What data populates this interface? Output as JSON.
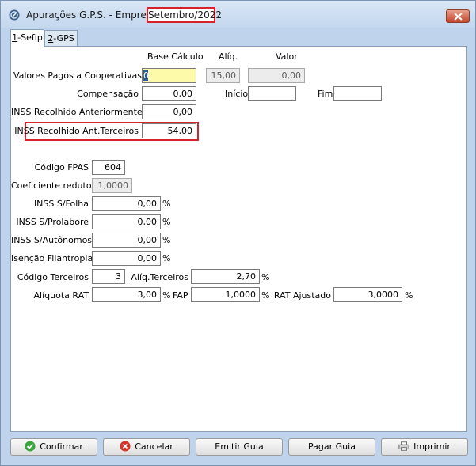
{
  "window": {
    "title": "Apurações G.P.S. - Empresa - ",
    "period": "Setembro/2022"
  },
  "tabs": [
    {
      "key": "1",
      "label": "-Sefip"
    },
    {
      "key": "2",
      "label": "-GPS"
    }
  ],
  "headers": {
    "base": "Base Cálculo",
    "aliq": "Alíq.",
    "valor": "Valor"
  },
  "form": {
    "cooperativas": {
      "label": "Valores Pagos a Cooperativas",
      "base": "0",
      "aliq": "15,00",
      "valor": "0,00"
    },
    "compensacao": {
      "label": "Compensação",
      "value": "0,00",
      "inicio_label": "Início",
      "inicio": "",
      "fim_label": "Fim",
      "fim": ""
    },
    "inss_anterior": {
      "label": "INSS Recolhido Anteriormente",
      "value": "0,00"
    },
    "inss_terceiros": {
      "label": "INSS Recolhido Ant.Terceiros",
      "value": "54,00"
    },
    "codigo_fpas": {
      "label": "Código FPAS",
      "value": "604"
    },
    "coef_redutor": {
      "label": "Coeficiente redutor",
      "value": "1,0000"
    },
    "inss_folha": {
      "label": "INSS S/Folha",
      "value": "0,00",
      "unit": "%"
    },
    "inss_prolabore": {
      "label": "INSS S/Prolabore",
      "value": "0,00",
      "unit": "%"
    },
    "inss_autonomos": {
      "label": "INSS S/Autônomos",
      "value": "0,00",
      "unit": "%"
    },
    "isencao": {
      "label": "Isenção Filantropia",
      "value": "0,00",
      "unit": "%"
    },
    "codigo_terceiros": {
      "label": "Código Terceiros",
      "value": "3"
    },
    "aliq_terceiros": {
      "label": "Alíq.Terceiros",
      "value": "2,70",
      "unit": "%"
    },
    "aliquota_rat": {
      "label": "Alíquota RAT",
      "value": "3,00",
      "unit": "%"
    },
    "fap": {
      "label": "FAP",
      "value": "1,0000",
      "unit": "%"
    },
    "rat_ajustado": {
      "label": "RAT Ajustado",
      "value": "3,0000",
      "unit": "%"
    }
  },
  "buttons": {
    "confirmar": "Confirmar",
    "cancelar": "Cancelar",
    "emitir": "Emitir Guia",
    "pagar": "Pagar Guia",
    "imprimir": "Imprimir"
  },
  "colors": {
    "highlight": "#d6222a",
    "accent_field": "#fdfbaa"
  }
}
